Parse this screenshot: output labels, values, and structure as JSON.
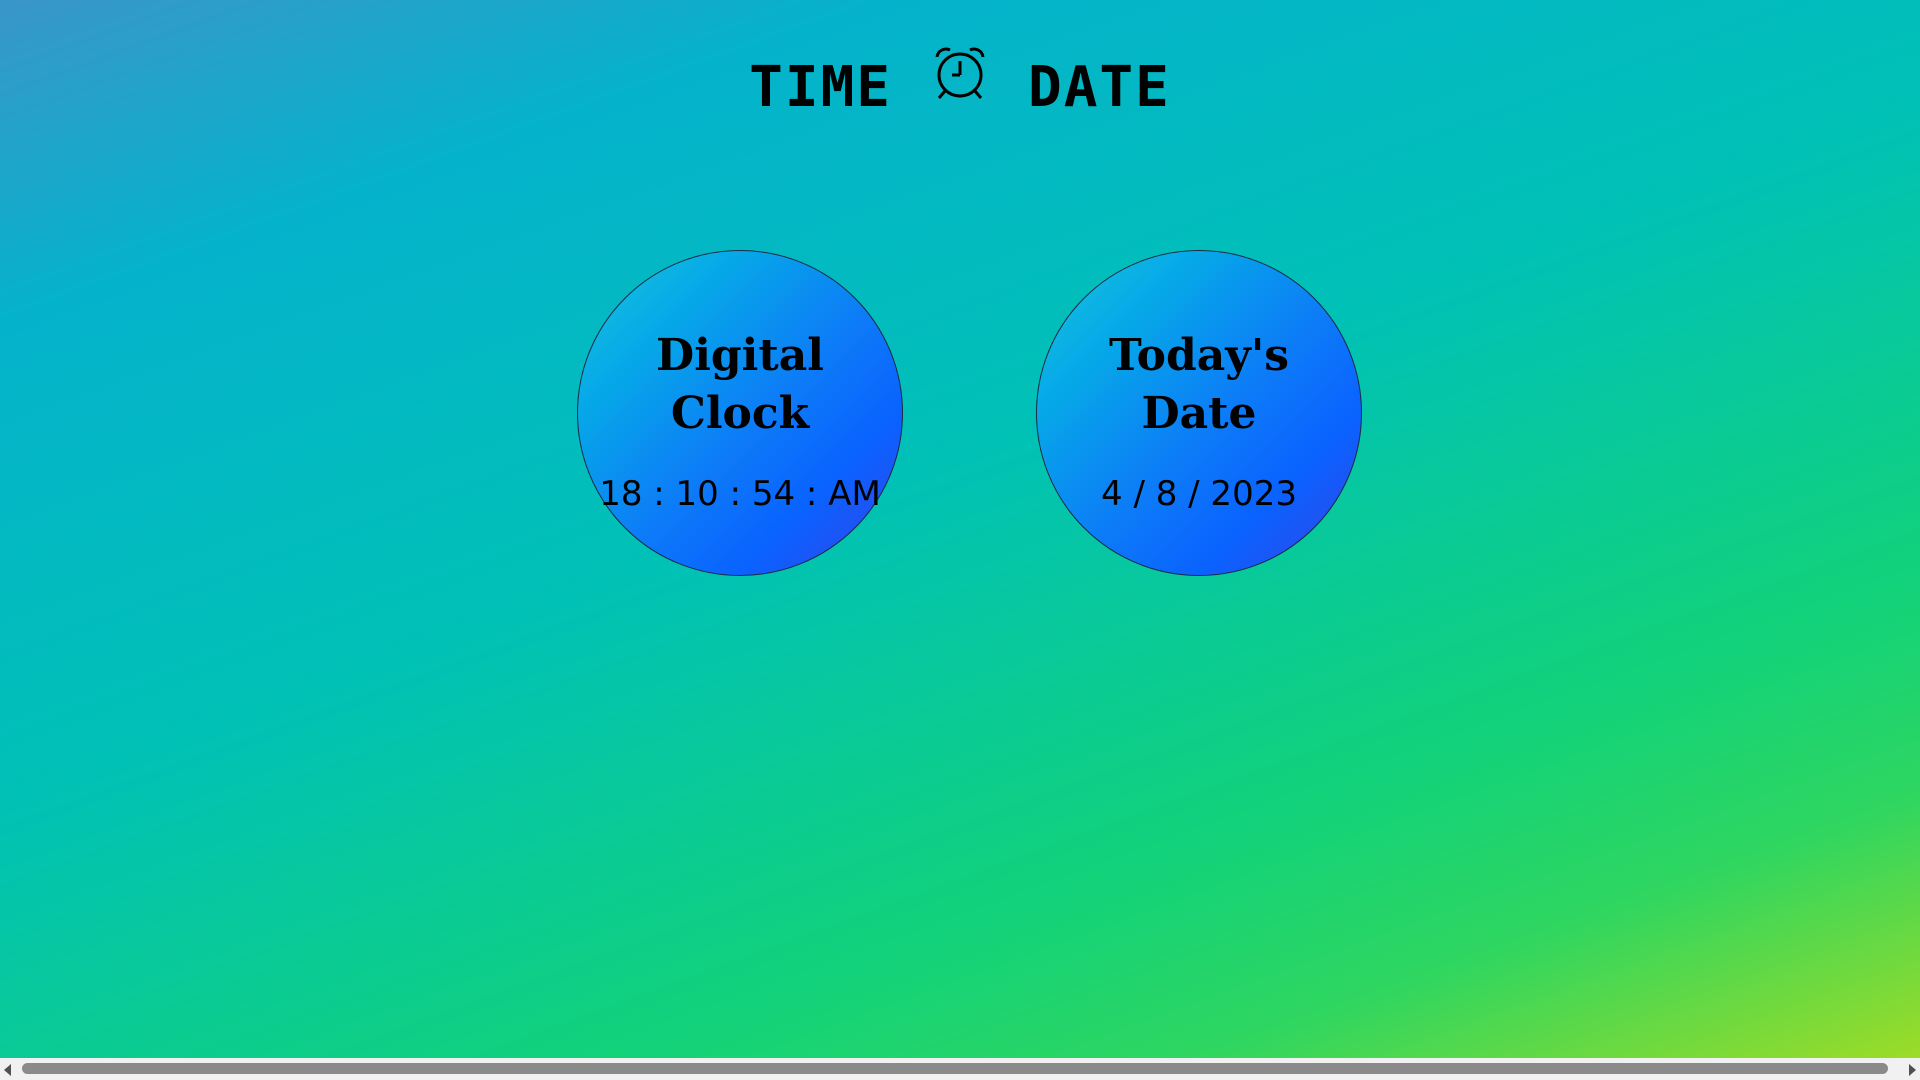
{
  "header": {
    "word_left": "TIME",
    "icon": "alarm-clock-icon",
    "word_right": "DATE"
  },
  "clock_card": {
    "title": "Digital\nClock",
    "value": "18 : 10 : 54 : AM"
  },
  "date_card": {
    "title": "Today's\nDate",
    "value": "4 / 8 / 2023"
  },
  "colors": {
    "circle_gradient_start": "#18c6dc",
    "circle_gradient_end": "#3a40e6",
    "text": "#000000",
    "scrollbar_thumb": "#8a8a8a"
  }
}
